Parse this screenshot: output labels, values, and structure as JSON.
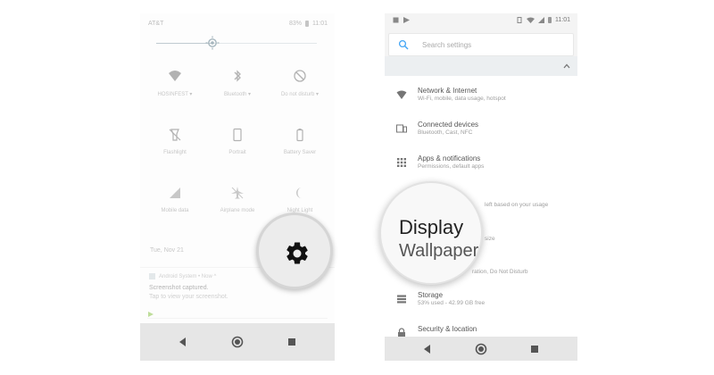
{
  "left_phone": {
    "status": {
      "carrier": "AT&T",
      "battery": "83%",
      "time": "11:01"
    },
    "brightness_level": 0.35,
    "tiles": [
      {
        "icon": "wifi-icon",
        "label": "HOSINFEST"
      },
      {
        "icon": "bluetooth-icon",
        "label": "Bluetooth"
      },
      {
        "icon": "do-not-disturb-icon",
        "label": "Do not disturb"
      },
      {
        "icon": "flashlight-icon",
        "label": "Flashlight"
      },
      {
        "icon": "portrait-icon",
        "label": "Portrait"
      },
      {
        "icon": "battery-saver-icon",
        "label": "Battery Saver"
      },
      {
        "icon": "mobile-data-icon",
        "label": "Mobile data"
      },
      {
        "icon": "airplane-mode-icon",
        "label": "Airplane mode"
      },
      {
        "icon": "night-light-icon",
        "label": "Night Light"
      }
    ],
    "date": "Tue, Nov 21",
    "notification": {
      "app": "Android System • Now ^",
      "title": "Screenshot captured.",
      "subtitle": "Tap to view your screenshot."
    }
  },
  "right_phone": {
    "status": {
      "time": "11:01"
    },
    "search_placeholder": "Search settings",
    "items": [
      {
        "icon": "wifi-icon",
        "title": "Network & Internet",
        "subtitle": "Wi-Fi, mobile, data usage, hotspot"
      },
      {
        "icon": "connected-devices-icon",
        "title": "Connected devices",
        "subtitle": "Bluetooth, Cast, NFC"
      },
      {
        "icon": "apps-icon",
        "title": "Apps & notifications",
        "subtitle": "Permissions, default apps"
      },
      {
        "icon": "battery-icon",
        "title": "",
        "subtitle": "left based on your usage"
      },
      {
        "icon": "display-icon",
        "title": "",
        "subtitle": "size"
      },
      {
        "icon": "sound-icon",
        "title": "",
        "subtitle": "ration, Do Not Disturb"
      },
      {
        "icon": "storage-icon",
        "title": "Storage",
        "subtitle": "53% used - 42.99 GB free"
      },
      {
        "icon": "lock-icon",
        "title": "Security & location",
        "subtitle": ""
      }
    ]
  },
  "zoom_callouts": {
    "gear": {
      "icon": "gear-icon"
    },
    "display": {
      "line1": "Display",
      "line2": "Wallpaper"
    }
  },
  "colors": {
    "accent": "#42a5f5",
    "navbar": "#e6e6e6"
  }
}
